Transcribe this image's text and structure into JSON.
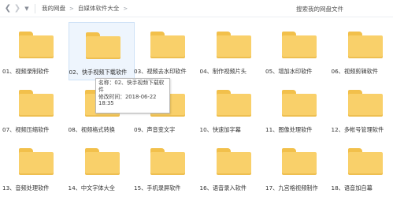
{
  "topbar": {
    "back_icon": "chevron-left-icon",
    "forward_icon": "chevron-right-icon",
    "dropdown_icon": "caret-down-icon",
    "breadcrumb": [
      "我的网盘",
      "自媒体软件大全"
    ],
    "separator": ">",
    "search_placeholder": "搜索我的网盘文件"
  },
  "folders": [
    {
      "label": "01、视频录制软件"
    },
    {
      "label": "02、快手视频下载软件"
    },
    {
      "label": "03、视频去水印软件"
    },
    {
      "label": "04、制作视频片头"
    },
    {
      "label": "05、增加水印软件"
    },
    {
      "label": "06、视频剪辑软件"
    },
    {
      "label": "07、视频压缩软件"
    },
    {
      "label": "08、视频格式转换"
    },
    {
      "label": "09、声音变文字"
    },
    {
      "label": "10、快速加字幕"
    },
    {
      "label": "11、图像处理软件"
    },
    {
      "label": "12、多帐号管理软件"
    },
    {
      "label": "13、音频处理软件"
    },
    {
      "label": "14、中文字体大全"
    },
    {
      "label": "15、手机录屏软件"
    },
    {
      "label": "16、语音录入软件"
    },
    {
      "label": "17、九宫格视频制作"
    },
    {
      "label": "18、语音加自幕"
    }
  ],
  "tooltip": {
    "name_line": "名称：02、快手视频下载软",
    "name_line_2": "件",
    "modified_line": "修改时间：2018-06-22",
    "time_line": "18:35"
  },
  "colors": {
    "folder": "#f9d06a",
    "folder_tab": "#f2c04b",
    "selection": "#eef5fd"
  }
}
